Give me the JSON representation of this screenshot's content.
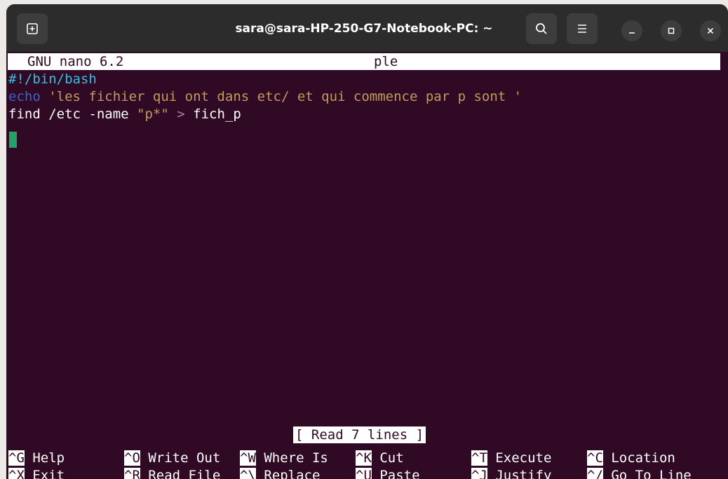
{
  "window": {
    "title": "sara@sara-HP-250-G7-Notebook-PC: ~",
    "new_tab_icon": "new-tab-icon",
    "search_icon": "search-icon",
    "menu_icon": "hamburger-menu-icon",
    "minimize_icon": "minimize-icon",
    "maximize_icon": "maximize-icon",
    "close_icon": "close-icon"
  },
  "nano": {
    "version": "GNU nano 6.2",
    "filename": "ple",
    "status": "[ Read 7 lines ]"
  },
  "editor": {
    "line1": "#!/bin/bash",
    "line2_kw": "echo",
    "line2_str": "'les fichier qui ont dans etc/ et qui commence par p sont '",
    "line3_a": "find /etc -name ",
    "line3_str": "\"p*\"",
    "line3_op": ">",
    "line3_b": " fich_p"
  },
  "shortcuts": [
    {
      "key": "^G",
      "label": "Help"
    },
    {
      "key": "^O",
      "label": "Write Out"
    },
    {
      "key": "^W",
      "label": "Where Is"
    },
    {
      "key": "^K",
      "label": "Cut"
    },
    {
      "key": "^T",
      "label": "Execute"
    },
    {
      "key": "^C",
      "label": "Location"
    },
    {
      "key": "^X",
      "label": "Exit"
    },
    {
      "key": "^R",
      "label": "Read File"
    },
    {
      "key": "^\\",
      "label": "Replace"
    },
    {
      "key": "^U",
      "label": "Paste"
    },
    {
      "key": "^J",
      "label": "Justify"
    },
    {
      "key": "^/",
      "label": "Go To Line"
    }
  ],
  "colors": {
    "terminal_bg": "#300a24",
    "titlebar_bg": "#2c2c2c",
    "comment": "#34c0e4",
    "keyword": "#3665c9",
    "string": "#c29a5d",
    "cursor": "#26a269"
  }
}
